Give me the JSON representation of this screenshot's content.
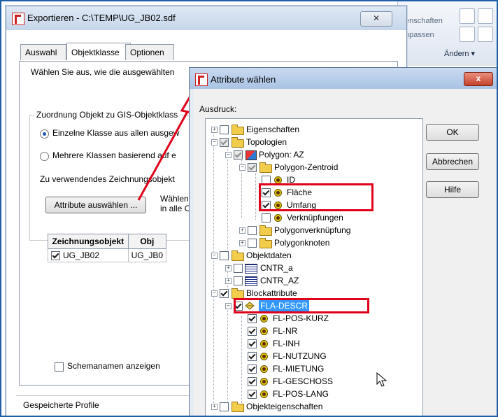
{
  "ribbon": {
    "item1": "enschaften",
    "item2": "npassen",
    "modify_label": "Ändern",
    "dropdown_icon": "chevron-down-icon"
  },
  "export_dialog": {
    "title": "Exportieren - C:\\TEMP\\UG_JB02.sdf",
    "close_glyph": "✕",
    "tabs": [
      "Auswahl",
      "Objektklasse",
      "Optionen"
    ],
    "intro_text": "Wählen Sie aus, wie die ausgewählten",
    "mapping_group_title": "Zuordnung Objekt zu GIS-Objektklass",
    "radio_single": "Einzelne Klasse aus allen ausgew",
    "radio_multiple": "Mehrere Klassen basierend auf e",
    "drawing_objects_label": "Zu verwendendes Zeichnungsobjekt",
    "attribute_button": "Attribute auswählen ...",
    "side_text_1": "Wählen",
    "side_text_2": "in alle O",
    "table_headers": [
      "Zeichnungsobjekt",
      "Obj"
    ],
    "table_rows": [
      {
        "name": "UG_JB02",
        "class": "UG_JB0"
      }
    ],
    "show_schema": "Schemanamen anzeigen",
    "saved_profiles": "Gespeicherte Profile"
  },
  "attr_dialog": {
    "title": "Attribute wählen",
    "close_glyph": "x",
    "expression_label": "Ausdruck:",
    "ok": "OK",
    "cancel": "Abbrechen",
    "help": "Hilfe",
    "tree": [
      "Eigenschaften",
      "Topologien",
      "Polygon: AZ",
      "Polygon-Zentroid",
      "ID",
      "Fläche",
      "Umfang",
      "Verknüpfungen",
      "Polygonverknüpfung",
      "Polygonknoten",
      "Objektdaten",
      "CNTR_a",
      "CNTR_AZ",
      "Blockattribute",
      "FLA-DESCR",
      "FL-POS-KURZ",
      "FL-NR",
      "FL-INH",
      "FL-NUTZUNG",
      "FL-MIETUNG",
      "FL-GESCHOSS",
      "FL-POS-LANG",
      "Objekteigenschaften"
    ]
  }
}
